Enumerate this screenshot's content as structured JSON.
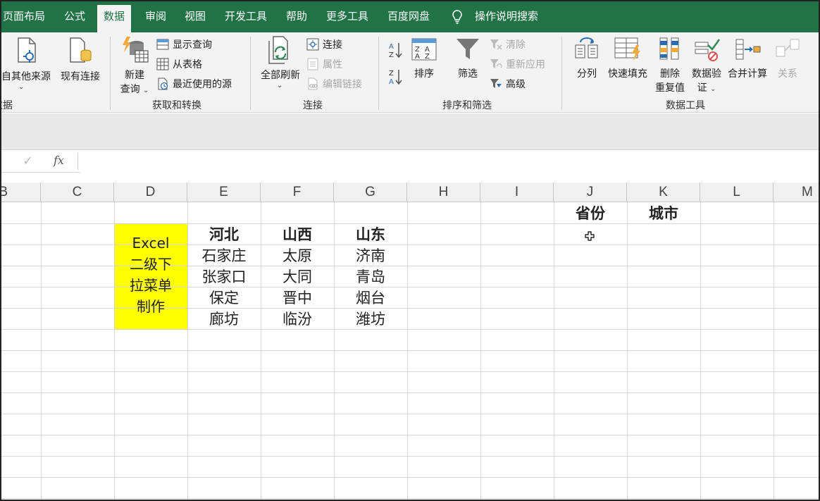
{
  "tabs": [
    {
      "label": "页面布局",
      "active": false
    },
    {
      "label": "公式",
      "active": false
    },
    {
      "label": "数据",
      "active": true
    },
    {
      "label": "审阅",
      "active": false
    },
    {
      "label": "视图",
      "active": false
    },
    {
      "label": "开发工具",
      "active": false
    },
    {
      "label": "帮助",
      "active": false
    },
    {
      "label": "更多工具",
      "active": false
    },
    {
      "label": "百度网盘",
      "active": false
    }
  ],
  "tell_me": "操作说明搜索",
  "ribbon": {
    "get_data": {
      "other_sources": "自其他来源",
      "existing_connections": "现有连接",
      "group_label": "获取外部数据"
    },
    "transform": {
      "new_query_line1": "新建",
      "new_query_line2": "查询",
      "show_queries": "显示查询",
      "from_table": "从表格",
      "recent_sources": "最近使用的源",
      "group_label": "获取和转换"
    },
    "connections": {
      "refresh_all": "全部刷新",
      "connections": "连接",
      "properties": "属性",
      "edit_links": "编辑链接",
      "group_label": "连接"
    },
    "sort_filter": {
      "sort": "排序",
      "filter": "筛选",
      "clear": "清除",
      "reapply": "重新应用",
      "advanced": "高级",
      "group_label": "排序和筛选"
    },
    "data_tools": {
      "text_to_columns": "分列",
      "flash_fill": "快速填充",
      "remove_dup_line1": "删除",
      "remove_dup_line2": "重复值",
      "validation_line1": "数据验",
      "validation_line2": "证",
      "consolidate": "合并计算",
      "relationships": "关系",
      "group_label": "数据工具"
    }
  },
  "formula_bar": {
    "fx": "fx",
    "check": "✓",
    "value": ""
  },
  "columns": [
    "B",
    "C",
    "D",
    "E",
    "F",
    "G",
    "H",
    "I",
    "J",
    "K",
    "L",
    "M"
  ],
  "cells": {
    "title_text": [
      "Excel",
      "二级下",
      "拉菜单",
      "制作"
    ],
    "provinces": [
      {
        "name": "河北",
        "cities": [
          "石家庄",
          "张家口",
          "保定",
          "廊坊"
        ]
      },
      {
        "name": "山西",
        "cities": [
          "太原",
          "大同",
          "晋中",
          "临汾"
        ]
      },
      {
        "name": "山东",
        "cities": [
          "济南",
          "青岛",
          "烟台",
          "潍坊"
        ]
      }
    ],
    "j_header": "省份",
    "k_header": "城市"
  },
  "colors": {
    "tabbar": "#217346",
    "highlight": "#ffff00"
  }
}
